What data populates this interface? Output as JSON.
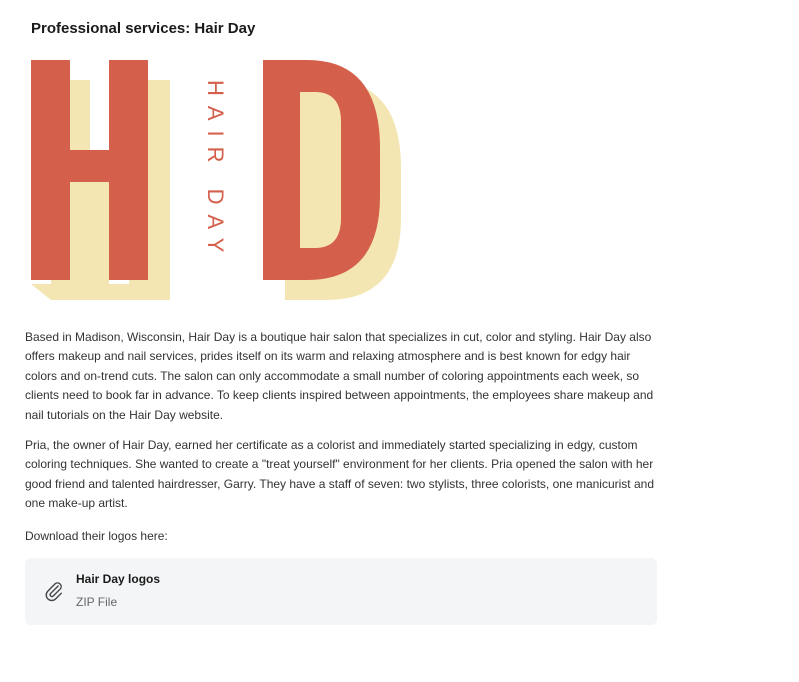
{
  "page_title": "Professional services: Hair Day",
  "logo": {
    "letters_left": "H",
    "letters_right": "D",
    "vertical_text": "HAIR DAY",
    "colors": {
      "primary": "#d4604c",
      "shadow": "#f4e6b2"
    }
  },
  "paragraphs": [
    "Based in Madison, Wisconsin, Hair Day is a boutique hair salon that specializes in cut, color and styling. Hair Day also offers makeup and nail services, prides itself on its warm and relaxing atmosphere and is best known for edgy hair colors and on-trend cuts. The salon can only accommodate a small number of coloring appointments each week, so clients need to book far in advance. To keep clients inspired between appointments, the employees share makeup and nail tutorials on the Hair Day website.",
    "Pria, the owner of Hair Day, earned her certificate as a colorist and immediately started specializing in edgy, custom coloring techniques. She wanted to create a \"treat yourself\" environment for her clients. Pria opened the salon with her good friend and talented hairdresser, Garry. They have a staff of seven: two stylists, three colorists, one manicurist and one make-up artist.",
    "Download their logos here:"
  ],
  "attachment": {
    "icon": "paperclip-icon",
    "name": "Hair Day logos",
    "type": "ZIP File"
  }
}
